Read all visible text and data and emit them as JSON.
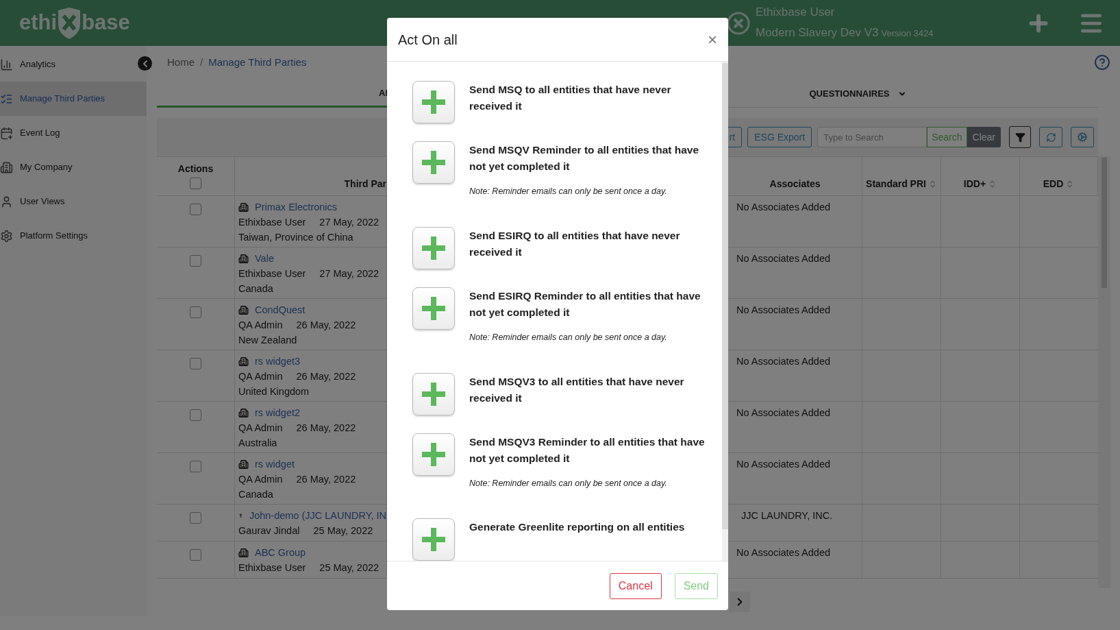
{
  "header": {
    "logo_left": "ethi",
    "logo_right": "base",
    "user": "Ethixbase User",
    "org": "Modern Slavery Dev V3",
    "version": "Version 3424"
  },
  "sidebar": {
    "items": [
      {
        "label": "Analytics",
        "selected": false
      },
      {
        "label": "Manage Third Parties",
        "selected": true
      },
      {
        "label": "Event Log",
        "selected": false
      },
      {
        "label": "My Company",
        "selected": false
      },
      {
        "label": "User Views",
        "selected": false
      },
      {
        "label": "Platform Settings",
        "selected": false
      }
    ]
  },
  "breadcrumb": [
    "Home",
    "Manage Third Parties"
  ],
  "breadcrumb_separator": "/",
  "tabs": [
    {
      "label": "Al",
      "selected": true,
      "dropdown": false
    },
    {
      "label": "QUESTIONNAIRES",
      "selected": false,
      "dropdown": true
    }
  ],
  "toolbar": {
    "buttons": [
      "rt",
      "ESG Export"
    ],
    "search_placeholder": "Type to Search",
    "search_button": "Search",
    "clear_button": "Clear"
  },
  "table": {
    "columns": [
      {
        "label": "Actions",
        "sortable": false
      },
      {
        "label": "Third Par",
        "sortable": false
      },
      {
        "label": "Associates",
        "sortable": false
      },
      {
        "label": "Standard PRI",
        "sortable": true
      },
      {
        "label": "IDD+",
        "sortable": true
      },
      {
        "label": "EDD",
        "sortable": true
      }
    ],
    "select_all_checked": false,
    "rows": [
      {
        "checked": false,
        "kind": "company",
        "name": "Primax Electronics",
        "user": "Ethixbase User",
        "date": "27 May, 2022",
        "country": "Taiwan, Province of China",
        "associates": "No Associates Added"
      },
      {
        "checked": false,
        "kind": "company",
        "name": "Vale",
        "user": "Ethixbase User",
        "date": "27 May, 2022",
        "country": "Canada",
        "associates": "No Associates Added"
      },
      {
        "checked": false,
        "kind": "company",
        "name": "CondQuest",
        "user": "QA Admin",
        "date": "26 May, 2022",
        "country": "New Zealand",
        "associates": "No Associates Added"
      },
      {
        "checked": false,
        "kind": "company",
        "name": "rs widget3",
        "user": "QA Admin",
        "date": "26 May, 2022",
        "country": "United Kingdom",
        "associates": "No Associates Added"
      },
      {
        "checked": false,
        "kind": "company",
        "name": "rs widget2",
        "user": "QA Admin",
        "date": "26 May, 2022",
        "country": "Australia",
        "associates": "No Associates Added"
      },
      {
        "checked": false,
        "kind": "company",
        "name": "rs widget",
        "user": "QA Admin",
        "date": "26 May, 2022",
        "country": "Canada",
        "associates": "No Associates Added"
      },
      {
        "checked": false,
        "kind": "person",
        "name": "John-demo (JJC LAUNDRY, IN",
        "user": "Gaurav Jindal",
        "date": "25 May, 2022",
        "associates": "JJC LAUNDRY, INC."
      },
      {
        "checked": false,
        "kind": "company",
        "name": "ABC Group",
        "user": "Ethixbase User",
        "date": "25 May, 2022",
        "associates": "No Associates Added"
      }
    ]
  },
  "modal": {
    "title": "Act On all",
    "close": "×",
    "actions": [
      {
        "text": "Send MSQ to all entities that have never received it"
      },
      {
        "text": "Send MSQV Reminder to all entities that have not yet completed it",
        "note": "Note: Reminder emails can only be sent once a day."
      },
      {
        "text": "Send ESIRQ to all entities that have never received it"
      },
      {
        "text": "Send ESIRQ Reminder to all entities that have not yet completed it",
        "note": "Note: Reminder emails can only be sent once a day."
      },
      {
        "text": "Send MSQV3 to all entities that have never received it"
      },
      {
        "text": "Send MSQV3 Reminder to all entities that have not yet completed it",
        "note": "Note: Reminder emails can only be sent once a day."
      },
      {
        "text": "Generate Greenlite reporting on all entities"
      }
    ],
    "cancel": "Cancel",
    "send": {
      "label": "Send",
      "disabled": true
    }
  }
}
